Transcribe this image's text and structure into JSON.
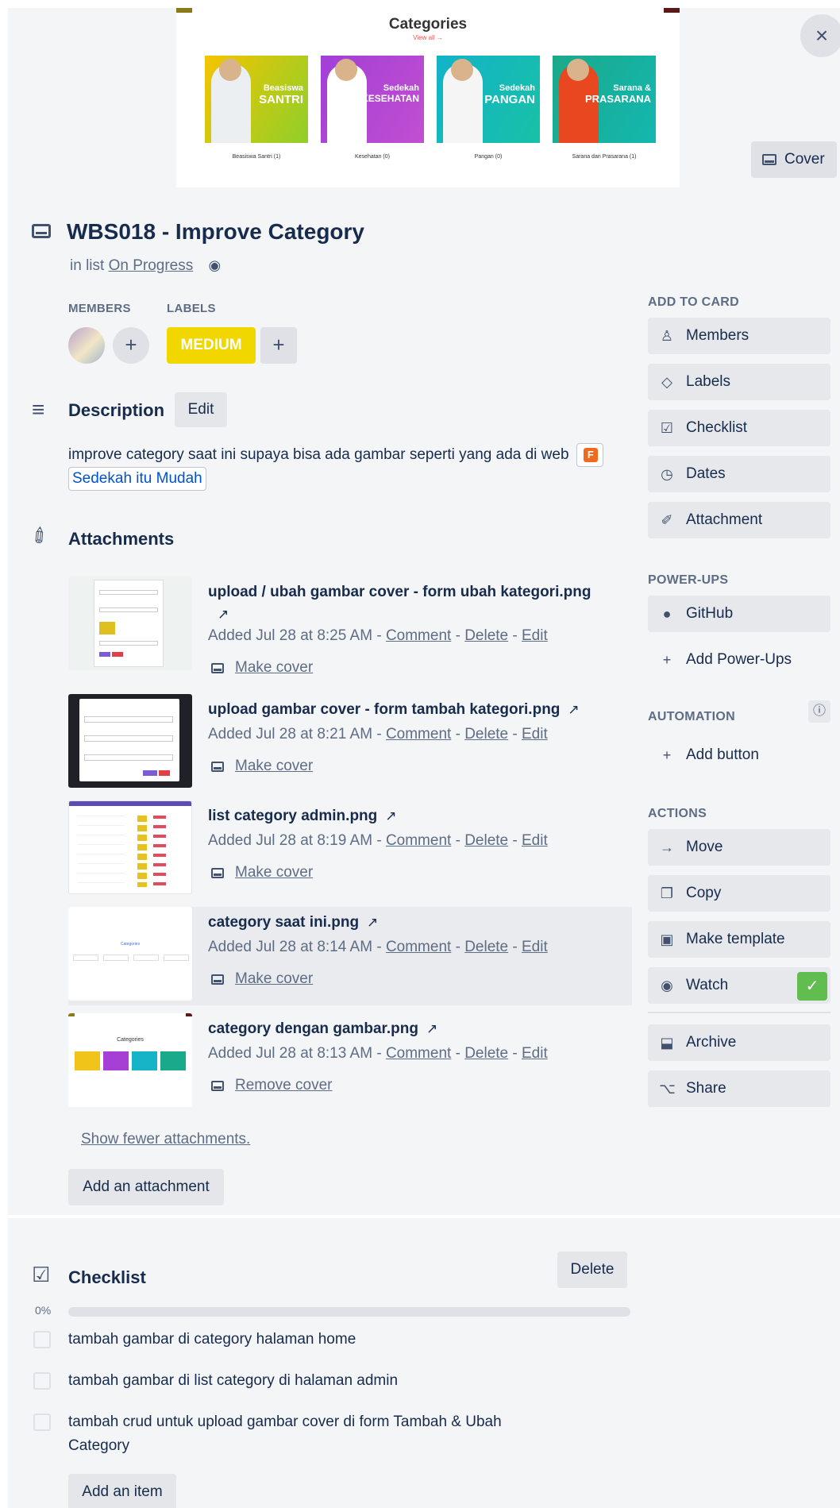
{
  "cover": {
    "image": {
      "title": "Categories",
      "view_all": "View all →",
      "categories": [
        {
          "line1": "Beasiswa",
          "line2": "SANTRI",
          "caption": "Beasiswa Santri (1)",
          "color": "#f5c400"
        },
        {
          "line1": "Sedekah",
          "line2": "KESEHATAN",
          "caption": "Kesehatan (0)",
          "color": "#a23fd6"
        },
        {
          "line1": "Sedekah",
          "line2": "PANGAN",
          "caption": "Pangan (0)",
          "color": "#12b3c9"
        },
        {
          "line1": "Sarana &",
          "line2": "PRASARANA",
          "caption": "Sarana dan Prasarana (1)",
          "color": "#1aa98a"
        }
      ]
    },
    "cover_button": "Cover",
    "close_icon": "×"
  },
  "card": {
    "title": "WBS018 - Improve Category",
    "in_list_prefix": "in list",
    "list_name": "On Progress",
    "members_label": "MEMBERS",
    "labels_label": "LABELS",
    "label_value": "MEDIUM",
    "label_color": "#f2d600"
  },
  "description": {
    "title": "Description",
    "edit": "Edit",
    "text": "improve category saat ini supaya bisa ada gambar seperti yang ada di web",
    "figma_letter": "F",
    "link_text": "Sedekah itu Mudah"
  },
  "attachments": {
    "title": "Attachments",
    "items": [
      {
        "name": "upload / ubah gambar cover - form ubah kategori.png",
        "added": "Added Jul 28 at 8:25 AM",
        "cover_action": "Make cover"
      },
      {
        "name": "upload gambar cover - form tambah kategori.png",
        "added": "Added Jul 28 at 8:21 AM",
        "cover_action": "Make cover"
      },
      {
        "name": "list category admin.png",
        "added": "Added Jul 28 at 8:19 AM",
        "cover_action": "Make cover"
      },
      {
        "name": "category saat ini.png",
        "added": "Added Jul 28 at 8:14 AM",
        "cover_action": "Make cover"
      },
      {
        "name": "category dengan gambar.png",
        "added": "Added Jul 28 at 8:13 AM",
        "cover_action": "Remove cover"
      }
    ],
    "comment": "Comment",
    "delete": "Delete",
    "edit": "Edit",
    "sep": " - ",
    "show_fewer": "Show fewer attachments.",
    "add": "Add an attachment"
  },
  "checklist": {
    "title": "Checklist",
    "delete": "Delete",
    "percent": "0%",
    "progress": 0,
    "items": [
      {
        "text": "tambah gambar di category halaman home",
        "checked": false
      },
      {
        "text": "tambah gambar di list category di halaman admin",
        "checked": false
      },
      {
        "text": "tambah crud untuk upload gambar cover di form Tambah & Ubah Category",
        "checked": false
      }
    ],
    "add_item": "Add an item"
  },
  "sidebar": {
    "add_to_card": "ADD TO CARD",
    "members": "Members",
    "labels": "Labels",
    "checklist": "Checklist",
    "dates": "Dates",
    "attachment": "Attachment",
    "power_ups": "POWER-UPS",
    "github": "GitHub",
    "add_power_ups": "Add Power-Ups",
    "automation": "AUTOMATION",
    "add_button": "Add button",
    "actions": "ACTIONS",
    "move": "Move",
    "copy": "Copy",
    "make_template": "Make template",
    "watch": "Watch",
    "archive": "Archive",
    "share": "Share"
  },
  "colors": {
    "background": "#f4f5f7",
    "button": "#e6e8eb",
    "watch_active": "#61bd4f",
    "link": "#0052cc"
  }
}
